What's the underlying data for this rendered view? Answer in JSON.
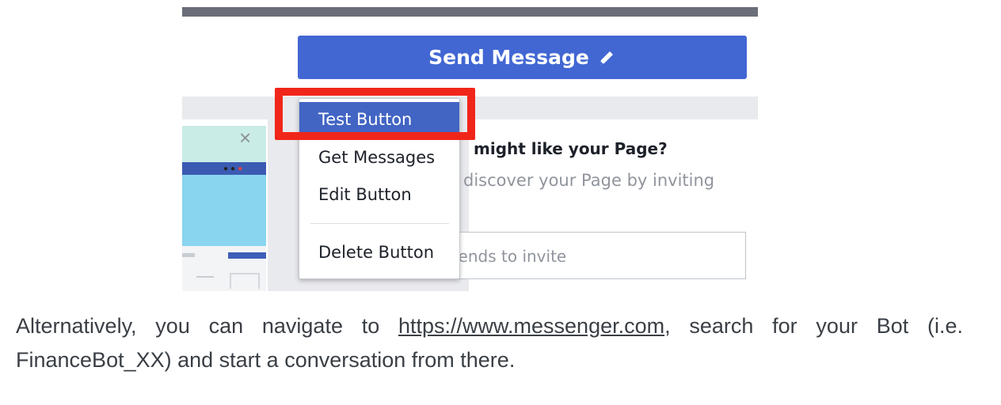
{
  "screenshot": {
    "send_button": {
      "label": "Send Message",
      "icon": "pencil-icon"
    },
    "menu": {
      "items": [
        {
          "label": "Test Button",
          "active": true
        },
        {
          "label": "Get Messages"
        },
        {
          "label": "Edit Button"
        },
        {
          "label": "Delete Button"
        }
      ]
    },
    "card": {
      "heading": "might like your Page?",
      "text": "discover your Page by inviting",
      "input_placeholder": "iends to invite"
    },
    "close_icon": "×",
    "colors": {
      "send_button": "#4267d3",
      "menu_active": "#4265c4",
      "highlight": "#f1261a"
    }
  },
  "caption": {
    "before_link": "Alternatively, you can navigate to ",
    "link": "https://www.messenger.com",
    "after_link": ", search for your Bot (i.e. FinanceBot_XX) and start a conversation from there."
  }
}
